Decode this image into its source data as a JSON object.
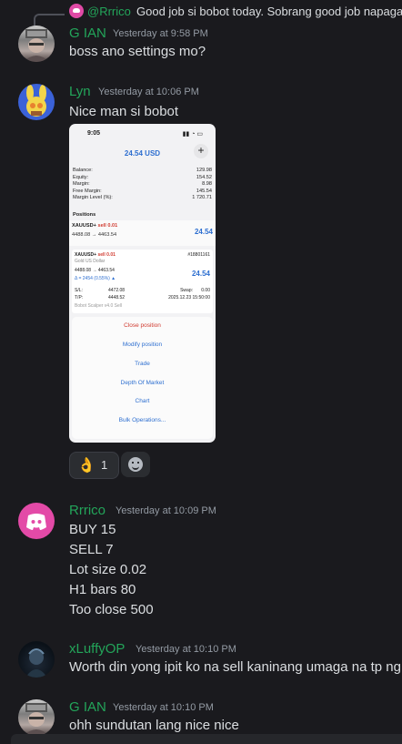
{
  "reply": {
    "author": "@Rrrico",
    "text": "Good job si bobot today. Sobrang good job napaga"
  },
  "messages": [
    {
      "author": "G IAN",
      "author_color": "#23a55a",
      "timestamp": "Yesterday at 9:58 PM",
      "lines": [
        "boss ano settings mo?"
      ]
    },
    {
      "author": "Lyn",
      "author_color": "#23a55a",
      "timestamp": "Yesterday at 10:06 PM",
      "lines": [
        "Nice man si bobot"
      ]
    },
    {
      "author": "Rrrico",
      "author_color": "#23a55a",
      "timestamp": "Yesterday at 10:09 PM",
      "lines": [
        "BUY 15",
        "SELL 7",
        "Lot size  0.02",
        "H1 bars  80",
        "Too close   500"
      ]
    },
    {
      "author": "xLuffyOP",
      "author_color": "#23a55a",
      "timestamp": "Yesterday at 10:10 PM",
      "lines": [
        "Worth din yong ipit ko na sell kaninang umaga na tp ng"
      ]
    },
    {
      "author": "G IAN",
      "author_color": "#23a55a",
      "timestamp": "Yesterday at 10:10 PM",
      "lines": [
        "ohh sundutan lang nice nice"
      ]
    }
  ],
  "attachment": {
    "status_time": "9:05",
    "title": "24.54 USD",
    "summary": [
      {
        "label": "Balance:",
        "value": "129.98"
      },
      {
        "label": "Equity:",
        "value": "154.52"
      },
      {
        "label": "Margin:",
        "value": "8.98"
      },
      {
        "label": "Free Margin:",
        "value": "145.54"
      },
      {
        "label": "Margin Level (%):",
        "value": "1 720.71"
      }
    ],
    "positions_label": "Positions",
    "position": {
      "symbol": "XAUUSD+",
      "side": "sell 0.01",
      "range": "4488.08 → 4463.54",
      "profit": "24.54"
    },
    "detail": {
      "id": "#18801161",
      "name": "Gold US Dollar",
      "range": "4488.08 → 4463.54",
      "profit": "24.54",
      "change": "Δ = 2454 (0.55%) ▲",
      "sl_label": "S/L:",
      "sl": "4472.08",
      "swap_label": "Swap:",
      "swap": "0.00",
      "tp_label": "T/P:",
      "tp": "4448.52",
      "date": "2025.12.23 15:50:00",
      "comment": "Bobot Scalper v4.0 Sell"
    },
    "menu": [
      "Close position",
      "Modify position",
      "Trade",
      "Depth Of Market",
      "Chart",
      "Bulk Operations..."
    ]
  },
  "reaction": {
    "emoji": "👌",
    "count": "1"
  },
  "colors": {
    "background": "#1a1a1e",
    "text": "#dbdee1",
    "username": "#23a55a",
    "timestamp": "#949ba4"
  }
}
